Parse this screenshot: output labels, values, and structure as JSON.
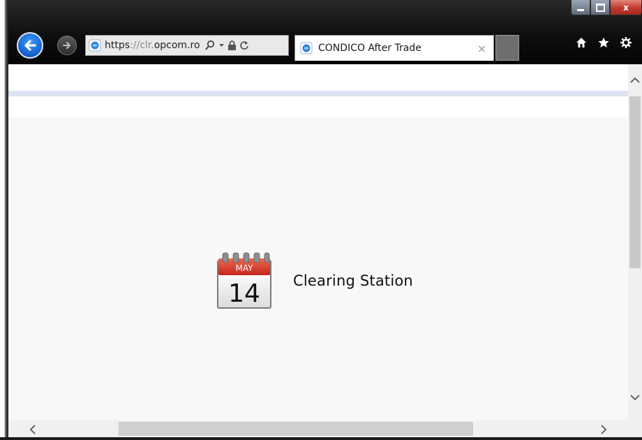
{
  "browser": {
    "address": {
      "protocol": "https",
      "separator": "://",
      "domain_prefix": "clr.",
      "domain": "opcom.ro"
    },
    "tab": {
      "title": "CONDICO After Trade",
      "close_glyph": "×"
    },
    "window_controls": {
      "close_glyph": "x"
    },
    "icons": [
      "back-arrow-icon",
      "forward-arrow-icon",
      "page-favicon-icon",
      "search-icon",
      "dropdown-icon",
      "lock-icon",
      "refresh-icon",
      "home-icon",
      "favorites-star-icon",
      "settings-gear-icon"
    ]
  },
  "page": {
    "app_tile": {
      "calendar_month": "MAY",
      "calendar_day": "14",
      "label": "Clearing Station"
    }
  },
  "colors": {
    "accent_blue": "#1560c9",
    "rule_blue": "#dde3f1",
    "calendar_red": "#d9342b"
  }
}
